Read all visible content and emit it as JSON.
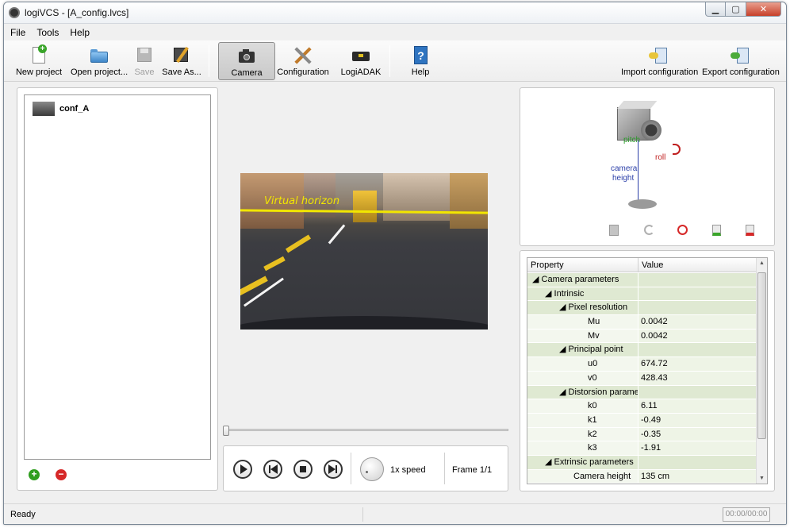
{
  "window": {
    "title": "logiVCS - [A_config.lvcs]"
  },
  "menu": {
    "items": [
      "File",
      "Tools",
      "Help"
    ]
  },
  "toolbar": {
    "new_project": "New project",
    "open_project": "Open project...",
    "save": "Save",
    "save_as": "Save As...",
    "camera": "Camera",
    "configuration": "Configuration",
    "logiadak": "LogiADAK",
    "help": "Help",
    "import_config": "Import configuration",
    "export_config": "Export configuration"
  },
  "projects": {
    "items": [
      {
        "label": "conf_A"
      }
    ]
  },
  "video": {
    "overlay_label": "Virtual horizon",
    "speed": "1x speed",
    "frame": "Frame 1/1",
    "slider_position": 0
  },
  "camera_diagram": {
    "pitch": "pitch",
    "roll": "roll",
    "height_line1": "camera",
    "height_line2": "height"
  },
  "properties": {
    "col_property": "Property",
    "col_value": "Value",
    "rows": [
      {
        "label": "Camera parameters",
        "value": ""
      },
      {
        "label": "Intrinsic",
        "value": ""
      },
      {
        "label": "Pixel resolution",
        "value": ""
      },
      {
        "label": "Mu",
        "value": "0.0042"
      },
      {
        "label": "Mv",
        "value": "0.0042"
      },
      {
        "label": "Principal point",
        "value": ""
      },
      {
        "label": "u0",
        "value": "674.72"
      },
      {
        "label": "v0",
        "value": "428.43"
      },
      {
        "label": "Distorsion parameters",
        "value": ""
      },
      {
        "label": "k0",
        "value": "6.11"
      },
      {
        "label": "k1",
        "value": "-0.49"
      },
      {
        "label": "k2",
        "value": "-0.35"
      },
      {
        "label": "k3",
        "value": "-1.91"
      },
      {
        "label": "Extrinsic parameters",
        "value": ""
      },
      {
        "label": "Camera height",
        "value": "135 cm"
      }
    ]
  },
  "status": {
    "text": "Ready",
    "time": "00:00/00:00"
  },
  "colors": {
    "accent_green": "#2f9e1f",
    "accent_red": "#d62828",
    "horizon_yellow": "#f2e600",
    "row_group": "#dfe9d2"
  }
}
